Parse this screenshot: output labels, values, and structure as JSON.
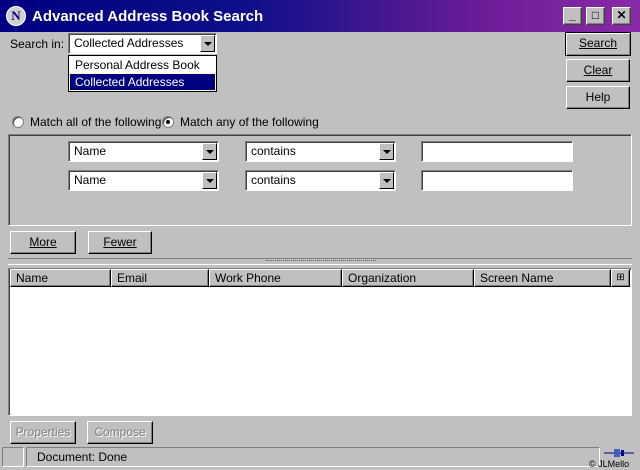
{
  "window": {
    "title": "Advanced Address Book Search",
    "logo_letter": "N",
    "minimize_glyph": "_",
    "maximize_glyph": "□",
    "close_glyph": "✕"
  },
  "search_in": {
    "label": "Search in:",
    "selected": "Collected Addresses",
    "options": [
      "Personal Address Book",
      "Collected Addresses"
    ]
  },
  "buttons": {
    "search": "Search",
    "clear": "Clear",
    "help": "Help",
    "more": "More",
    "fewer": "Fewer",
    "properties": "Properties",
    "compose": "Compose"
  },
  "match": {
    "all_label": "Match all of the following",
    "any_label": "Match any of the following",
    "selected": "any"
  },
  "criteria": [
    {
      "field": "Name",
      "operator": "contains",
      "value": ""
    },
    {
      "field": "Name",
      "operator": "contains",
      "value": ""
    }
  ],
  "results": {
    "columns": [
      "Name",
      "Email",
      "Work Phone",
      "Organization",
      "Screen Name"
    ],
    "rows": []
  },
  "status": {
    "text": "Document: Done",
    "credit": "© JLMello"
  }
}
